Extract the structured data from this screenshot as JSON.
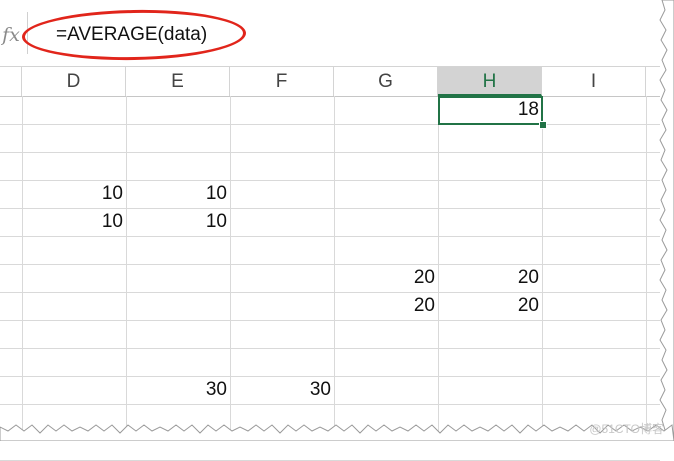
{
  "formula_bar": {
    "fx_label": "fx",
    "formula": "=AVERAGE(data)"
  },
  "columns": [
    "D",
    "E",
    "F",
    "G",
    "H",
    "I"
  ],
  "selected_column": "H",
  "cells": [
    {
      "col": "H",
      "row": 0,
      "value": "18"
    },
    {
      "col": "D",
      "row": 3,
      "value": "10"
    },
    {
      "col": "E",
      "row": 3,
      "value": "10"
    },
    {
      "col": "D",
      "row": 4,
      "value": "10"
    },
    {
      "col": "E",
      "row": 4,
      "value": "10"
    },
    {
      "col": "G",
      "row": 6,
      "value": "20"
    },
    {
      "col": "H",
      "row": 6,
      "value": "20"
    },
    {
      "col": "G",
      "row": 7,
      "value": "20"
    },
    {
      "col": "H",
      "row": 7,
      "value": "20"
    },
    {
      "col": "E",
      "row": 10,
      "value": "30"
    },
    {
      "col": "F",
      "row": 10,
      "value": "30"
    }
  ],
  "active_cell": {
    "col": "H",
    "row": 0
  },
  "watermark": "@51CTO博客",
  "colors": {
    "accent": "#217346",
    "annotation": "#e1251b",
    "grid": "#d9d9d9"
  }
}
